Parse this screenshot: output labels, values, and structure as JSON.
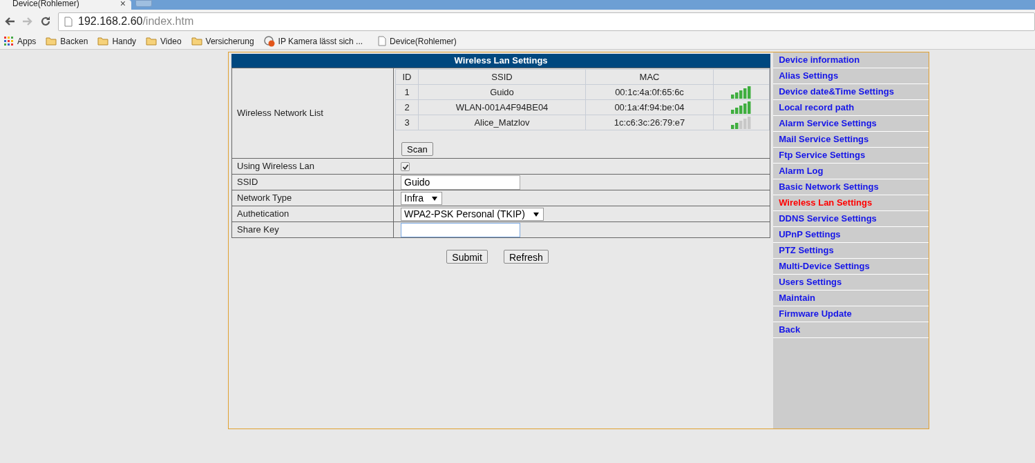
{
  "browser": {
    "tab": {
      "title": "Device(Rohlemer)",
      "close": "×"
    },
    "address": {
      "host": "192.168.2.60",
      "path": "/index.htm"
    },
    "bookmarks": [
      {
        "kind": "apps",
        "label": "Apps"
      },
      {
        "kind": "folder",
        "label": "Backen"
      },
      {
        "kind": "folder",
        "label": "Handy"
      },
      {
        "kind": "folder",
        "label": "Video"
      },
      {
        "kind": "folder",
        "label": "Versicherung"
      },
      {
        "kind": "site",
        "label": "IP Kamera lässt sich ..."
      },
      {
        "kind": "page",
        "label": "Device(Rohlemer)"
      }
    ]
  },
  "panel": {
    "title": "Wireless Lan Settings",
    "network_list": {
      "label": "Wireless Network List",
      "columns": [
        "ID",
        "SSID",
        "MAC"
      ],
      "rows": [
        {
          "id": "1",
          "ssid": "Guido",
          "mac": "00:1c:4a:0f:65:6c",
          "kind": "strong"
        },
        {
          "id": "2",
          "ssid": "WLAN-001A4F94BE04",
          "mac": "00:1a:4f:94:be:04",
          "kind": "strong"
        },
        {
          "id": "3",
          "ssid": "Alice_Matzlov",
          "mac": "1c:c6:3c:26:79:e7",
          "kind": "weak"
        }
      ],
      "scan_button": "Scan"
    },
    "fields": [
      {
        "kind": "checkbox",
        "label": "Using Wireless Lan",
        "checked": true
      },
      {
        "kind": "text",
        "label": "SSID",
        "value": "Guido"
      },
      {
        "kind": "select",
        "label": "Network Type",
        "value": "Infra"
      },
      {
        "kind": "select",
        "label": "Authetication",
        "value": "WPA2-PSK Personal (TKIP)"
      },
      {
        "kind": "text",
        "label": "Share Key",
        "focused": true
      }
    ],
    "buttons": [
      "Submit",
      "Refresh"
    ]
  },
  "sidebar": {
    "items": [
      {
        "label": "Device information",
        "selected": false
      },
      {
        "label": "Alias Settings",
        "selected": false
      },
      {
        "label": "Device date&Time Settings",
        "selected": false
      },
      {
        "label": "Local record path",
        "selected": false
      },
      {
        "label": "Alarm Service Settings",
        "selected": false
      },
      {
        "label": "Mail Service Settings",
        "selected": false
      },
      {
        "label": "Ftp Service Settings",
        "selected": false
      },
      {
        "label": "Alarm Log",
        "selected": false
      },
      {
        "label": "Basic Network Settings",
        "selected": false
      },
      {
        "label": "Wireless Lan Settings",
        "selected": true
      },
      {
        "label": "DDNS Service Settings",
        "selected": false
      },
      {
        "label": "UPnP Settings",
        "selected": false
      },
      {
        "label": "PTZ Settings",
        "selected": false
      },
      {
        "label": "Multi-Device Settings",
        "selected": false
      },
      {
        "label": "Users Settings",
        "selected": false
      },
      {
        "label": "Maintain",
        "selected": false
      },
      {
        "label": "Firmware Update",
        "selected": false
      },
      {
        "label": "Back",
        "selected": false
      }
    ]
  }
}
